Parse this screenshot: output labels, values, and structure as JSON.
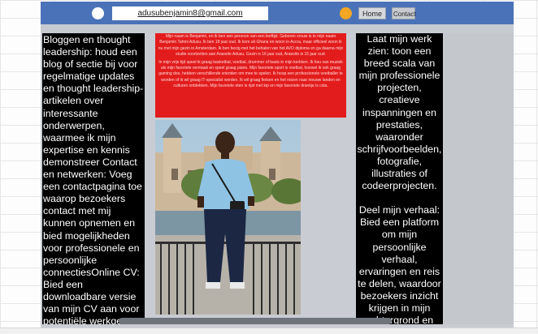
{
  "header": {
    "email": "adusubenjamin8@gmail.com",
    "nav": {
      "home_label": "Home",
      "contact_label": "Contact"
    }
  },
  "left_column": {
    "text": "Bloggen en thought leadership: houd een blog of sectie bij voor regelmatige updates en thought leadership-artikelen over interessante onderwerpen, waarmee ik mijn expertise en kennis demonstreer Contact en netwerken: Voeg een contactpagina toe waarop bezoekers contact met mij kunnen opnemen en bied mogelijkheden voor professionele en persoonlijke connectiesOnline CV: Bied een downloadbare versie van mijn CV aan voor potentiële werkgevers of"
  },
  "intro": {
    "paragraph_1": "Mijn naam is Benjamin, en ik ben een persoon van een leeftijd. Geboren vrouw is in mijn naam Benjamin Tahmi Adusu. Ik ben 18 jaar oud. Ik kom uit Ghana en woon in Accra, maar officieel woon ik nu met mijn gezin in Amsterdam. Ik ben bezig met het behalen van het AVO diploma en ga daarna mijn studie voortzetten aan Arasoite Adusu. Gezin is 16 jaar oud, Arasoite is 15 jaar oud.",
    "paragraph_2": "In mijn vrije tijd speel ik graag basketbal, voetbal, drummer of basis in mijn kerkken. Ik hou van muziek als mijn favoriete vermaak en speel graag piano. Mijn favoriete sport is voetbal, hoewel ik ook graag gaming doe, hebben verschillende vrienden om mee te spelen. Ik hoop een professionele voetballer te worden of ik wil graag IT-specialist worden. Ik wil graag fietsen en het reizen naar nieuwe landen en culturen ontdekken. Mijn favoriete eten is rijst met kip en mijn favoriete drankje is cola."
  },
  "right_column": {
    "paragraph_1": "Laat mijn werk zien: toon een breed scala van mijn professionele projecten, creatieve inspanningen en prestaties, waaronder schrijfvoorbeelden, fotografie, illustraties of codeerprojecten.",
    "paragraph_2": "Deel mijn verhaal: Bied een platform om mijn persoonlijke verhaal, ervaringen en reis te delen, waardoor bezoekers inzicht krijgen in mijn achtergrond en passies."
  },
  "colors": {
    "topbar": "#4a72b8",
    "accent_orange": "#f5a623",
    "intro_red": "#e21c1c",
    "column_bg": "#000000"
  },
  "icons": {
    "left_dot": "white-circle-icon",
    "right_dot": "orange-circle-icon"
  }
}
